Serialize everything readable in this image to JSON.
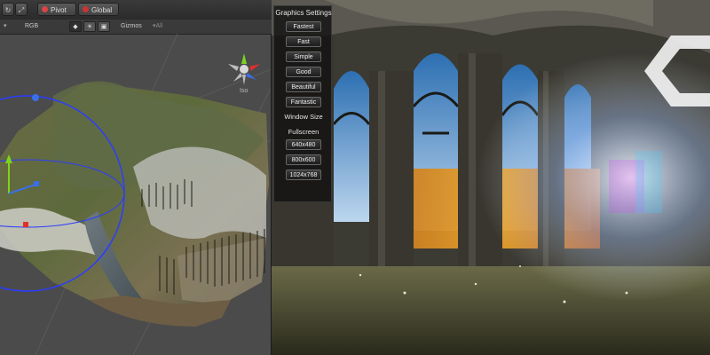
{
  "editor": {
    "toolbar": {
      "pivot_label": "Pivot",
      "global_label": "Global"
    },
    "scene_bar": {
      "render_mode": "RGB",
      "gizmos_label": "Gizmos",
      "search_placeholder": "▾All"
    },
    "gizmo": {
      "projection_label": "Iso"
    }
  },
  "game_view": {
    "graphics_settings": {
      "title": "Graphics Settings",
      "quality_buttons": [
        "Fastest",
        "Fast",
        "Simple",
        "Good",
        "Beautiful",
        "Fantastic"
      ],
      "window_size_label": "Window Size",
      "fullscreen_label": "Fullscreen",
      "resolution_buttons": [
        "640x480",
        "800x600",
        "1024x768"
      ]
    }
  },
  "colors": {
    "editor_bg": "#4b4b4b",
    "toolbar_bg": "#2e2e2e",
    "axis_x": "#e0302c",
    "axis_y": "#7ed321",
    "axis_z": "#3a6fe8",
    "selection_blue": "#2b3dff"
  }
}
